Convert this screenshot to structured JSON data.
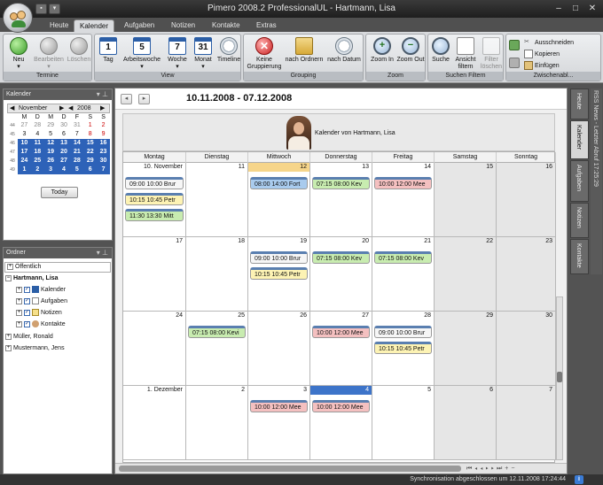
{
  "window": {
    "title": "Pimero 2008.2 ProfessionalUL - Hartmann, Lisa",
    "controls": [
      "–",
      "□",
      "✕"
    ]
  },
  "ribbon_tabs": [
    "Heute",
    "Kalender",
    "Aufgaben",
    "Notizen",
    "Kontakte",
    "Extras"
  ],
  "active_ribbon_tab": "Kalender",
  "ribbon": {
    "groups": {
      "termine": "Termine",
      "view": "View",
      "grouping": "Grouping",
      "zoom": "Zoom",
      "suchen_filtern": "Suchen Filtern",
      "zwischenablage": "Zwischenabl..."
    },
    "buttons": {
      "neu": "Neu",
      "bearbeiten": "Bearbeiten",
      "loeschen": "Löschen",
      "tag": "Tag",
      "arbeitswoche": "Arbeitswoche",
      "woche": "Woche",
      "monat": "Monat",
      "timeline": "Timeline",
      "keine_gruppierung": "Keine Gruppierung",
      "nach_ordnern": "nach Ordnern",
      "nach_datum": "nach Datum",
      "zoom_in": "Zoom In",
      "zoom_out": "Zoom Out",
      "suche": "Suche",
      "ansicht_filtern": "Ansicht filtern",
      "filter_loeschen": "Filter löschen",
      "ausschneiden": "Ausschneiden",
      "kopieren": "Kopieren",
      "einfuegen": "Einfügen"
    },
    "icons": {
      "tag": "1",
      "arbeitswoche": "5",
      "woche": "7",
      "monat": "31"
    }
  },
  "calendar_panel": {
    "title": "Kalender",
    "month": "November",
    "year": "2008",
    "weekdays": [
      "M",
      "D",
      "M",
      "D",
      "F",
      "S",
      "S"
    ],
    "weeks": [
      {
        "wk": "44",
        "days": [
          "27",
          "28",
          "29",
          "30",
          "31",
          "1",
          "2"
        ],
        "selected": false
      },
      {
        "wk": "45",
        "days": [
          "3",
          "4",
          "5",
          "6",
          "7",
          "8",
          "9"
        ],
        "selected": false
      },
      {
        "wk": "46",
        "days": [
          "10",
          "11",
          "12",
          "13",
          "14",
          "15",
          "16"
        ],
        "selected": true
      },
      {
        "wk": "47",
        "days": [
          "17",
          "18",
          "19",
          "20",
          "21",
          "22",
          "23"
        ],
        "selected": true
      },
      {
        "wk": "48",
        "days": [
          "24",
          "25",
          "26",
          "27",
          "28",
          "29",
          "30"
        ],
        "selected": true
      },
      {
        "wk": "49",
        "days": [
          "1",
          "2",
          "3",
          "4",
          "5",
          "6",
          "7"
        ],
        "selected": true
      }
    ],
    "today_button": "Today"
  },
  "folder_panel": {
    "title": "Ordner",
    "items": {
      "oeffentlich": "Öffentlich",
      "hartmann": "Hartmann, Lisa",
      "kalender": "Kalender",
      "aufgaben": "Aufgaben",
      "notizen": "Notizen",
      "kontakte": "Kontakte",
      "mueller": "Müller, Ronald",
      "mustermann": "Mustermann, Jens"
    }
  },
  "main": {
    "date_range": "10.11.2008 - 07.12.2008",
    "owner_label": "Kalender von Hartmann, Lisa",
    "weekdays": [
      "Montag",
      "Dienstag",
      "Mittwoch",
      "Donnerstag",
      "Freitag",
      "Samstag",
      "Sonntag"
    ],
    "weeks": [
      {
        "days": [
          "10. November",
          "11",
          "12",
          "13",
          "14",
          "15",
          "16"
        ],
        "appts": [
          [
            {
              "t": "09:00  10:00  Brur",
              "c": "white"
            },
            {
              "t": "10:15  10:45  Petr",
              "c": "yellow"
            },
            {
              "t": "11:30  13:30  Mitt",
              "c": "green"
            }
          ],
          [],
          [
            {
              "t": "08:00  14:00  Fort",
              "c": "blue"
            }
          ],
          [
            {
              "t": "07:15  08:00  Kev",
              "c": "green"
            }
          ],
          [
            {
              "t": "10:00  12:00  Mee",
              "c": "red"
            }
          ],
          [],
          []
        ]
      },
      {
        "days": [
          "17",
          "18",
          "19",
          "20",
          "21",
          "22",
          "23"
        ],
        "appts": [
          [],
          [],
          [
            {
              "t": "09:00  10:00  Brur",
              "c": "white"
            },
            {
              "t": "10:15  10:45  Petr",
              "c": "yellow"
            }
          ],
          [
            {
              "t": "07:15  08:00  Kev",
              "c": "green"
            }
          ],
          [
            {
              "t": "07:15  08:00  Kev",
              "c": "green"
            }
          ],
          [],
          []
        ]
      },
      {
        "days": [
          "24",
          "25",
          "26",
          "27",
          "28",
          "29",
          "30"
        ],
        "appts": [
          [],
          [
            {
              "t": "07:15  08:00  Kevi",
              "c": "green"
            }
          ],
          [],
          [
            {
              "t": "10:00  12:00  Mee",
              "c": "red"
            }
          ],
          [
            {
              "t": "09:00  10:00  Brur",
              "c": "white"
            },
            {
              "t": "10:15  10:45  Petr",
              "c": "yellow"
            }
          ],
          [],
          []
        ]
      },
      {
        "days": [
          "1. Dezember",
          "2",
          "3",
          "4",
          "5",
          "6",
          "7"
        ],
        "appts": [
          [],
          [],
          [
            {
              "t": "10:00  12:00  Mee",
              "c": "red"
            }
          ],
          [
            {
              "t": "10:00  12:00  Mee",
              "c": "red"
            }
          ],
          [],
          [],
          []
        ]
      }
    ],
    "today_cell": "12",
    "selected_cell": "4"
  },
  "side_tabs": [
    "Heute",
    "Kalender",
    "Aufgaben",
    "Notizen",
    "Kontakte"
  ],
  "rss_text": "RSS News - Letzter Abruf 17:25:29",
  "status": {
    "text": "Synchronisation abgeschlossen um 12.11.2008 17:24:44",
    "info_icon": "i"
  }
}
